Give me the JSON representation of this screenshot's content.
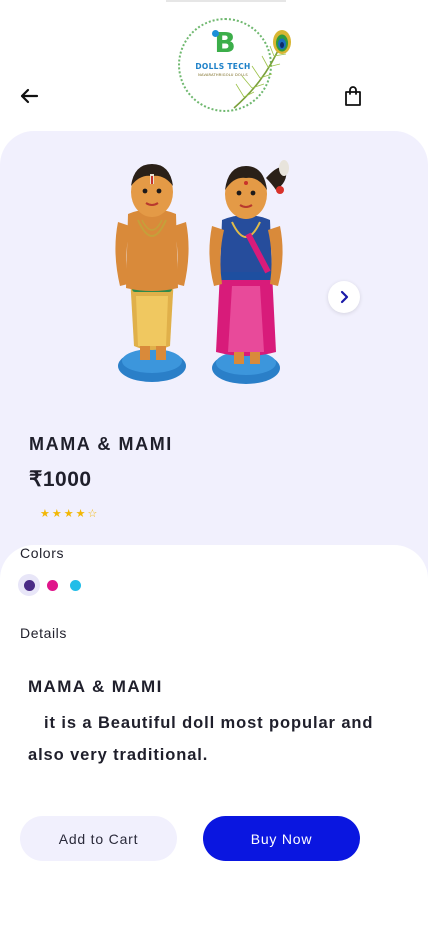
{
  "logo": {
    "brand": "DOLLS TECH",
    "tagline": "NAVARATHRIGOLU DOLLS",
    "mark": "B"
  },
  "header": {
    "back_icon": "arrow-left-icon",
    "bag_icon": "shopping-bag-icon"
  },
  "product": {
    "name": "MAMA & MAMI",
    "price": "₹1000",
    "rating": 4,
    "rating_max": 5,
    "image": "couple-doll-figurines",
    "next_icon": "chevron-right-icon"
  },
  "colors": {
    "label": "Colors",
    "options": [
      {
        "name": "purple",
        "hex": "#4a2b86",
        "selected": true
      },
      {
        "name": "pink",
        "hex": "#e0158b",
        "selected": false
      },
      {
        "name": "sky-blue",
        "hex": "#22bde8",
        "selected": false
      }
    ]
  },
  "details": {
    "label": "Details",
    "title": "MAMA & MAMI",
    "body": "it is a Beautiful doll most popular and also very traditional."
  },
  "actions": {
    "add_to_cart": "Add to Cart",
    "buy_now": "Buy Now"
  },
  "theme": {
    "accent": "#0a16e0",
    "card_bg": "#f1f0fd",
    "star": "#f2b705"
  }
}
